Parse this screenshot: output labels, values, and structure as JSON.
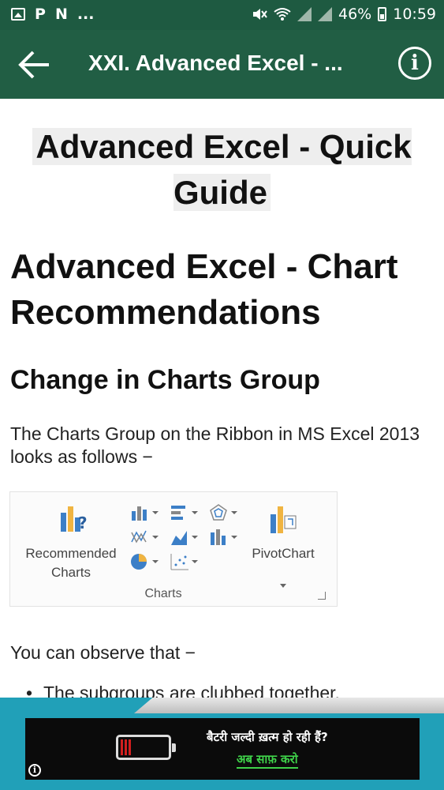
{
  "status_bar": {
    "left_icons": [
      "image-icon",
      "P",
      "N",
      "..."
    ],
    "battery_percent": "46%",
    "time": "10:59"
  },
  "app_bar": {
    "title": "XXI. Advanced Excel - ...",
    "back_icon": "back-arrow-icon",
    "info_icon": "info-icon",
    "info_glyph": "i"
  },
  "content": {
    "doc_title": "Advanced Excel - Quick Guide",
    "heading": "Advanced Excel - Chart Recommendations",
    "subheading": "Change in Charts Group",
    "intro": "The Charts Group on the Ribbon in MS Excel 2013 looks as follows −",
    "ribbon": {
      "recommended_label": "Recommended Charts",
      "pivot_label": "PivotChart",
      "group_label": "Charts"
    },
    "observe": "You can observe that −",
    "bullet_1": "The subgroups are clubbed together."
  },
  "ad": {
    "line1": "बैटरी जल्दी ख़त्म हो रही हैं?",
    "line2": "अब साफ़ करो",
    "info_glyph": "i",
    "battery_level": 0.25,
    "colors": {
      "background": "#21a0b8",
      "accent": "#3fd24a",
      "battery": "#d21f1f"
    }
  },
  "colors": {
    "status_bar": "#1e5a41",
    "app_bar": "#215e44"
  }
}
